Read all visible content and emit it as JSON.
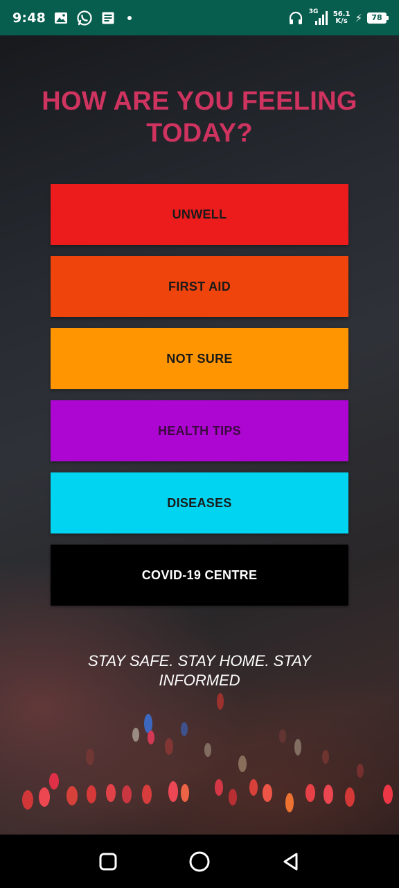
{
  "status_bar": {
    "time": "9:48",
    "left_icons": [
      "image-icon",
      "whatsapp-icon",
      "message-icon"
    ],
    "network": "3G",
    "speed_value": "56.1",
    "speed_unit": "K/s",
    "battery": "78"
  },
  "main": {
    "title": "HOW ARE YOU FEELING TODAY?",
    "buttons": [
      {
        "label": "UNWELL",
        "color": "#ec1c1c"
      },
      {
        "label": "FIRST AID",
        "color": "#f0440d"
      },
      {
        "label": "NOT SURE",
        "color": "#ff9500"
      },
      {
        "label": "HEALTH TIPS",
        "color": "#ae06d2"
      },
      {
        "label": "DISEASES",
        "color": "#01d4f0"
      },
      {
        "label": "COVID-19 CENTRE",
        "color": "#000000"
      }
    ],
    "tagline": "STAY SAFE. STAY HOME. STAY INFORMED"
  },
  "colors": {
    "status_bar": "#075e4f",
    "title": "#cf3360",
    "background": "#272b31",
    "nav_bar": "#000000"
  },
  "nav_bar": {
    "buttons": [
      "recents-square-icon",
      "home-circle-icon",
      "back-triangle-icon"
    ]
  }
}
